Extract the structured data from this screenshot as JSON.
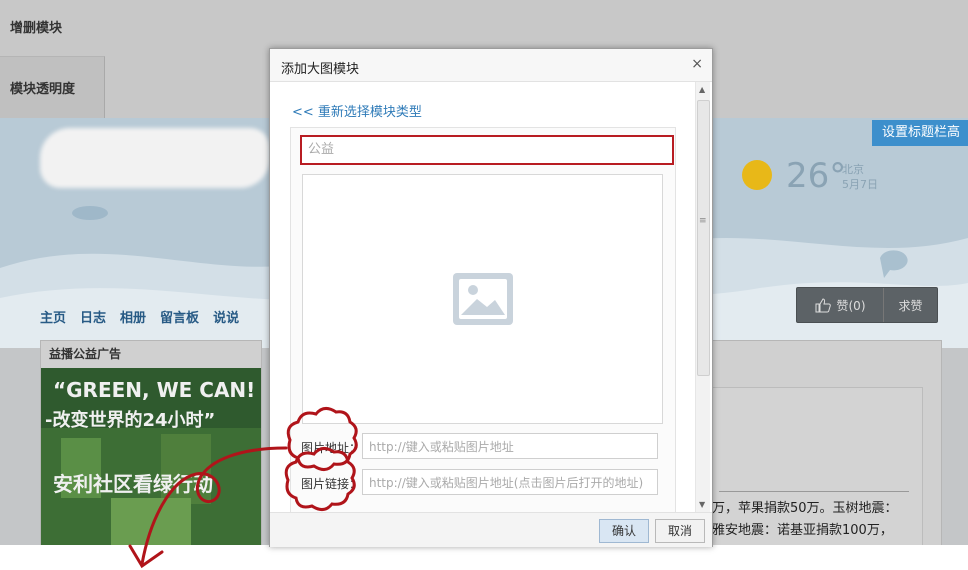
{
  "background": {
    "panel_add_delete": "增删模块",
    "panel_transparency": "模块透明度",
    "settings_button": "设置标题栏高",
    "weather": {
      "temperature": "26°",
      "city": "北京",
      "date": "5月7日"
    },
    "nav": [
      "主页",
      "日志",
      "相册",
      "留言板",
      "说说"
    ],
    "like_label": "赞(0)",
    "ask_like_label": "求赞",
    "ad_card_title": "益播公益广告",
    "ad_line1": "“GREEN, WE CAN!",
    "ad_line2": "-改变世界的24小时”",
    "ad_line3": "安利社区看绿行动",
    "news_line1": "万，苹果捐款50万。玉树地震：",
    "news_line2": "雅安地震：诺基亚捐款100万，"
  },
  "dialog": {
    "title": "添加大图模块",
    "close_glyph": "×",
    "reselect_link": "<< 重新选择模块类型",
    "title_input_placeholder": "公益",
    "image_url_label": "图片地址：",
    "image_url_placeholder": "http://键入或粘贴图片地址",
    "image_link_label": "图片链接：",
    "image_link_placeholder": "http://键入或粘贴图片地址(点击图片后打开的地址)",
    "confirm_button": "确认",
    "cancel_button": "取消"
  },
  "colors": {
    "accent_link": "#2f7bb8",
    "input_highlight": "#b81c22",
    "annotation_red": "#b0141a",
    "settings_blue": "#3d8fcc"
  }
}
